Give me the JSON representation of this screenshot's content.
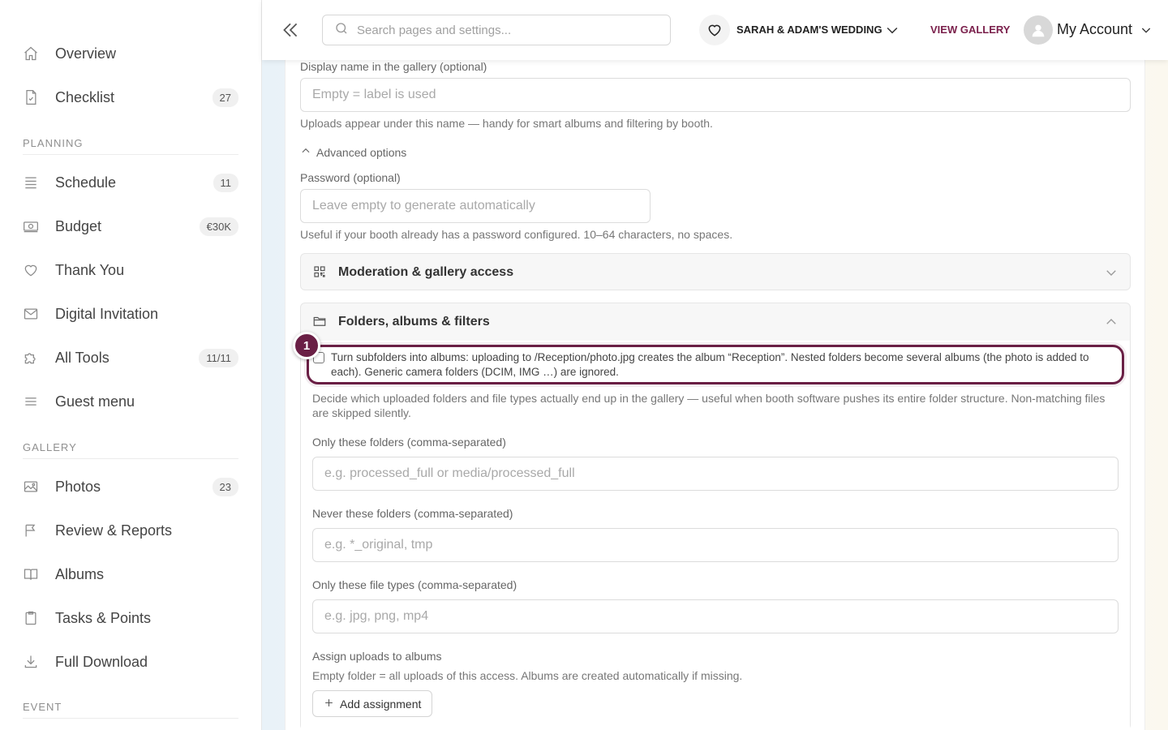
{
  "sidebar": {
    "items": [
      {
        "label": "Overview",
        "icon": "home-icon"
      },
      {
        "label": "Checklist",
        "icon": "checklist-icon",
        "badge": "27"
      },
      {
        "label": "Schedule",
        "icon": "schedule-icon",
        "badge": "11"
      },
      {
        "label": "Budget",
        "icon": "budget-icon",
        "badge": "€30K"
      },
      {
        "label": "Thank You",
        "icon": "heart-icon"
      },
      {
        "label": "Digital Invitation",
        "icon": "mail-icon"
      },
      {
        "label": "All Tools",
        "icon": "puzzle-icon",
        "badge": "11/11"
      },
      {
        "label": "Guest menu",
        "icon": "menu-icon"
      },
      {
        "label": "Photos",
        "icon": "photo-icon",
        "badge": "23"
      },
      {
        "label": "Review & Reports",
        "icon": "flag-icon"
      },
      {
        "label": "Albums",
        "icon": "book-icon"
      },
      {
        "label": "Tasks & Points",
        "icon": "clipboard-icon"
      },
      {
        "label": "Full Download",
        "icon": "download-icon"
      }
    ],
    "sections": {
      "planning": "PLANNING",
      "gallery": "GALLERY",
      "event": "EVENT"
    }
  },
  "topbar": {
    "search_placeholder": "Search pages and settings...",
    "event_name": "SARAH & ADAM'S WEDDING",
    "view_gallery": "VIEW GALLERY",
    "account": "My Account"
  },
  "form": {
    "display_name_label": "Display name in the gallery (optional)",
    "display_name_placeholder": "Empty = label is used",
    "display_name_help": "Uploads appear under this name — handy for smart albums and filtering by booth.",
    "advanced_toggle": "Advanced options",
    "password_label": "Password (optional)",
    "password_placeholder": "Leave empty to generate automatically",
    "password_help": "Useful if your booth already has a password configured. 10–64 characters, no spaces.",
    "moderation_title": "Moderation & gallery access",
    "folders_title": "Folders, albums & filters",
    "subfolders_checkbox": "Turn subfolders into albums: uploading to /Reception/photo.jpg creates the album “Reception”. Nested folders become several albums (the photo is added to each). Generic camera folders (DCIM, IMG …) are ignored.",
    "subfolders_checked": false,
    "step_number": "1",
    "folders_help": "Decide which uploaded folders and file types actually end up in the gallery — useful when booth software pushes its entire folder structure. Non-matching files are skipped silently.",
    "only_folders_label": "Only these folders (comma-separated)",
    "only_folders_placeholder": "e.g. processed_full or media/processed_full",
    "never_folders_label": "Never these folders (comma-separated)",
    "never_folders_placeholder": "e.g. *_original, tmp",
    "file_types_label": "Only these file types (comma-separated)",
    "file_types_placeholder": "e.g. jpg, png, mp4",
    "assign_label": "Assign uploads to albums",
    "assign_help": "Empty folder = all uploads of this access. Albums are created automatically if missing.",
    "add_assignment": "Add assignment"
  },
  "colors": {
    "accent": "#6a1f45",
    "view_gallery": "#7a1f4b"
  }
}
